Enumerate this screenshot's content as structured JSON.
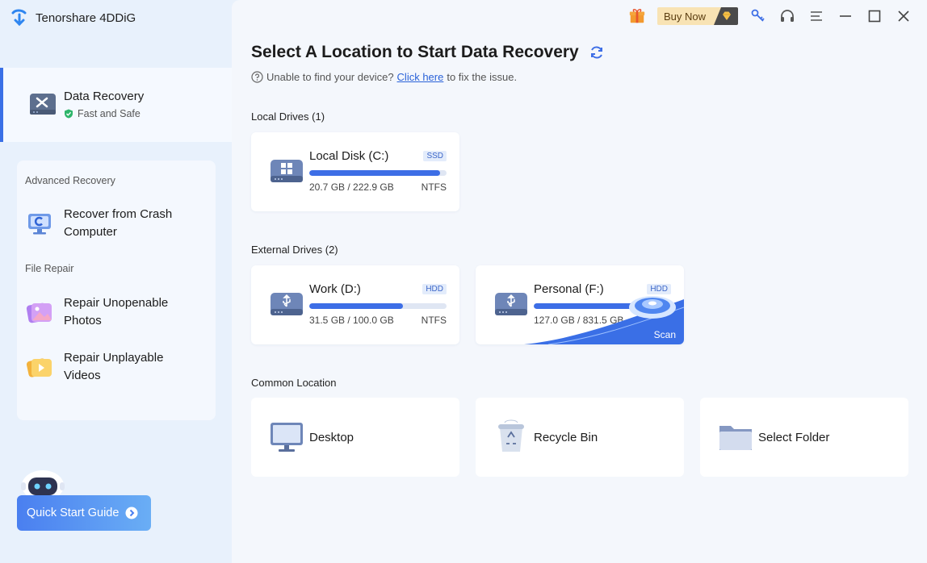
{
  "app": {
    "title": "Tenorshare 4DDiG"
  },
  "sidebar": {
    "active": {
      "title": "Data Recovery",
      "subtitle": "Fast and Safe"
    },
    "sections": [
      {
        "label": "Advanced Recovery"
      },
      {
        "label": "File Repair"
      }
    ],
    "items": [
      {
        "label": "Recover from Crash Computer",
        "icon": "crash-computer-icon"
      },
      {
        "label": "Repair Unopenable Photos",
        "icon": "photo-repair-icon"
      },
      {
        "label": "Repair Unplayable Videos",
        "icon": "video-repair-icon"
      }
    ],
    "quick_start": "Quick Start Guide"
  },
  "topbar": {
    "buy_now": "Buy Now",
    "icons": [
      "gift-icon",
      "key-icon",
      "headset-icon",
      "menu-icon",
      "minimize-icon",
      "maximize-icon",
      "close-icon"
    ]
  },
  "main": {
    "title": "Select A Location to Start Data Recovery",
    "hint_prefix": "Unable to find your device?",
    "hint_link": "Click here",
    "hint_suffix": "to fix the issue.",
    "local_label": "Local Drives (1)",
    "external_label": "External Drives (2)",
    "common_label": "Common Location",
    "local_drives": [
      {
        "name": "Local Disk (C:)",
        "type": "SSD",
        "used": "20.7 GB / 222.9 GB",
        "fs": "NTFS",
        "fill_pct": 95
      }
    ],
    "external_drives": [
      {
        "name": "Work (D:)",
        "type": "HDD",
        "used": "31.5 GB / 100.0 GB",
        "fs": "NTFS",
        "fill_pct": 68
      },
      {
        "name": "Personal (F:)",
        "type": "HDD",
        "used": "127.0 GB / 831.5 GB",
        "fs": "",
        "fill_pct": 80,
        "scan_label": "Scan"
      }
    ],
    "common": [
      {
        "name": "Desktop"
      },
      {
        "name": "Recycle Bin"
      },
      {
        "name": "Select Folder"
      }
    ]
  },
  "colors": {
    "accent": "#3d6ee6",
    "sidebar_bg": "#e8f1fc",
    "main_bg": "#f4f7fc"
  }
}
